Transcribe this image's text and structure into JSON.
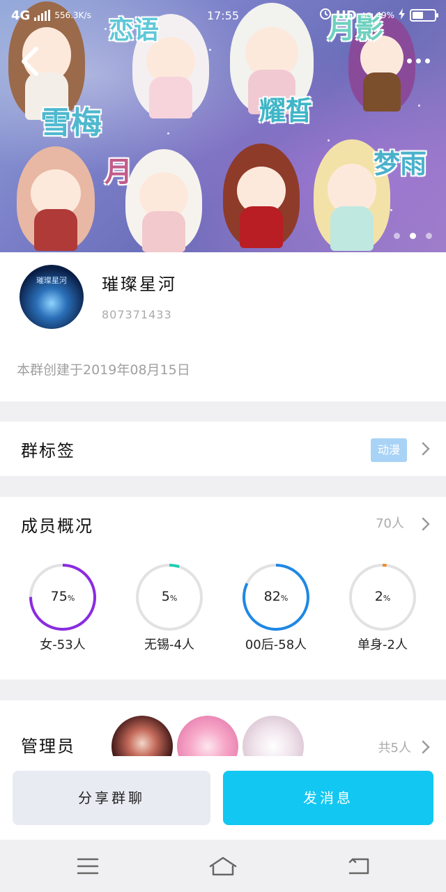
{
  "status_bar": {
    "network": "4G",
    "speed": "556.3K/s",
    "time": "17:55",
    "hd": "HD",
    "network_right": "4G",
    "battery_percent": 49,
    "battery_label": "49%"
  },
  "banner": {
    "labels": [
      "恋语",
      "月影",
      "雪梅",
      "耀皙",
      "梦雨",
      "月"
    ],
    "page_count": 3,
    "active_page": 2
  },
  "group": {
    "avatar_text": "璀璨星河",
    "name": "璀璨星河",
    "id": "807371433",
    "created_text": "本群创建于2019年08月15日"
  },
  "tags": {
    "title": "群标签",
    "value": "动漫"
  },
  "members": {
    "title": "成员概况",
    "count": "70人",
    "stats": [
      {
        "value": "75",
        "unit": "%",
        "percent": 75,
        "label": "女-53人",
        "color": "#8a2be2"
      },
      {
        "value": "5",
        "unit": "%",
        "percent": 5,
        "label": "无锡-4人",
        "color": "#1ccfb2"
      },
      {
        "value": "82",
        "unit": "%",
        "percent": 82,
        "label": "00后-58人",
        "color": "#1e88e5"
      },
      {
        "value": "2",
        "unit": "%",
        "percent": 2,
        "label": "单身-2人",
        "color": "#ef8a2a"
      }
    ]
  },
  "admins": {
    "title": "管理员",
    "total": "共5人"
  },
  "actions": {
    "share": "分享群聊",
    "send": "发消息"
  }
}
